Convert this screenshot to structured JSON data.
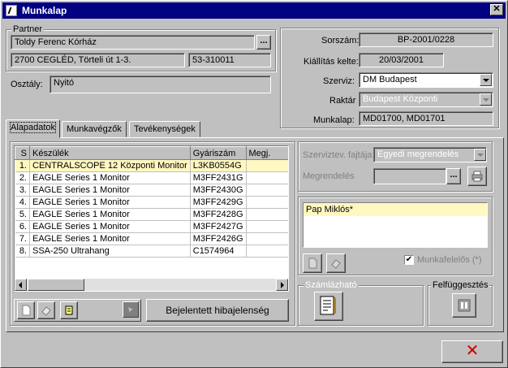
{
  "window": {
    "title": "Munkalap",
    "close_glyph": "✕"
  },
  "partner": {
    "group_label": "Partner",
    "name": "Toldy Ferenc Kórház",
    "address": "2700 CEGLÉD, Törteli út 1-3.",
    "phone": "53-310011",
    "browse_label": "..."
  },
  "osztaly": {
    "label": "Osztály:",
    "value": "Nyitó"
  },
  "header": {
    "sorszam_label": "Sorszám:",
    "sorszam": "BP-2001/0228",
    "kiallitas_label": "Kiállítás kelte:",
    "kiallitas": "20/03/2001",
    "szerviz_label": "Szerviz:",
    "szerviz": "DM Budapest",
    "raktar_label": "Raktár",
    "raktar": "Budapest Központi",
    "munkalap_label": "Munkalap:",
    "munkalap": "MD01700, MD01701"
  },
  "tabs": [
    {
      "label": "Alapadatok"
    },
    {
      "label": "Munkavégzők"
    },
    {
      "label": "Tevékenységek"
    }
  ],
  "table": {
    "columns": [
      "S",
      "Készülék",
      "Gyáriszám",
      "Megj."
    ],
    "rows": [
      {
        "n": "1.",
        "device": "CENTRALSCOPE 12 Központi Monitor",
        "serial": "L3KB0554G",
        "note": ""
      },
      {
        "n": "2.",
        "device": "EAGLE Series 1 Monitor",
        "serial": "M3FF2431G",
        "note": ""
      },
      {
        "n": "3.",
        "device": "EAGLE Series 1 Monitor",
        "serial": "M3FF2430G",
        "note": ""
      },
      {
        "n": "4.",
        "device": "EAGLE Series 1 Monitor",
        "serial": "M3FF2429G",
        "note": ""
      },
      {
        "n": "5.",
        "device": "EAGLE Series 1 Monitor",
        "serial": "M3FF2428G",
        "note": ""
      },
      {
        "n": "6.",
        "device": "EAGLE Series 1 Monitor",
        "serial": "M3FF2427G",
        "note": ""
      },
      {
        "n": "7.",
        "device": "EAGLE Series 1 Monitor",
        "serial": "M3FF2426G",
        "note": ""
      },
      {
        "n": "8.",
        "device": "SSA-250 Ultrahang",
        "serial": "C1574964",
        "note": ""
      }
    ],
    "selected_row": 0
  },
  "bejelentett_button": "Bejelentett hibajelenség",
  "right_panel": {
    "szervizt_label": "Szerviztev. fajtája:",
    "szervizt_value": "Egyedi megrendelés",
    "megrendeles_label": "Megrendelés",
    "megrendeles_browse": "...",
    "workers": [
      "Pap Miklós*"
    ],
    "munkafelelos_label": "Munkafelelős (*)",
    "munkafelelos_checked": true,
    "szamlazhato_label": "Számlázható",
    "felfuggesztes_label": "Felfüggesztés"
  },
  "footer": {
    "close_glyph": "✕",
    "close_color": "#d00000"
  }
}
